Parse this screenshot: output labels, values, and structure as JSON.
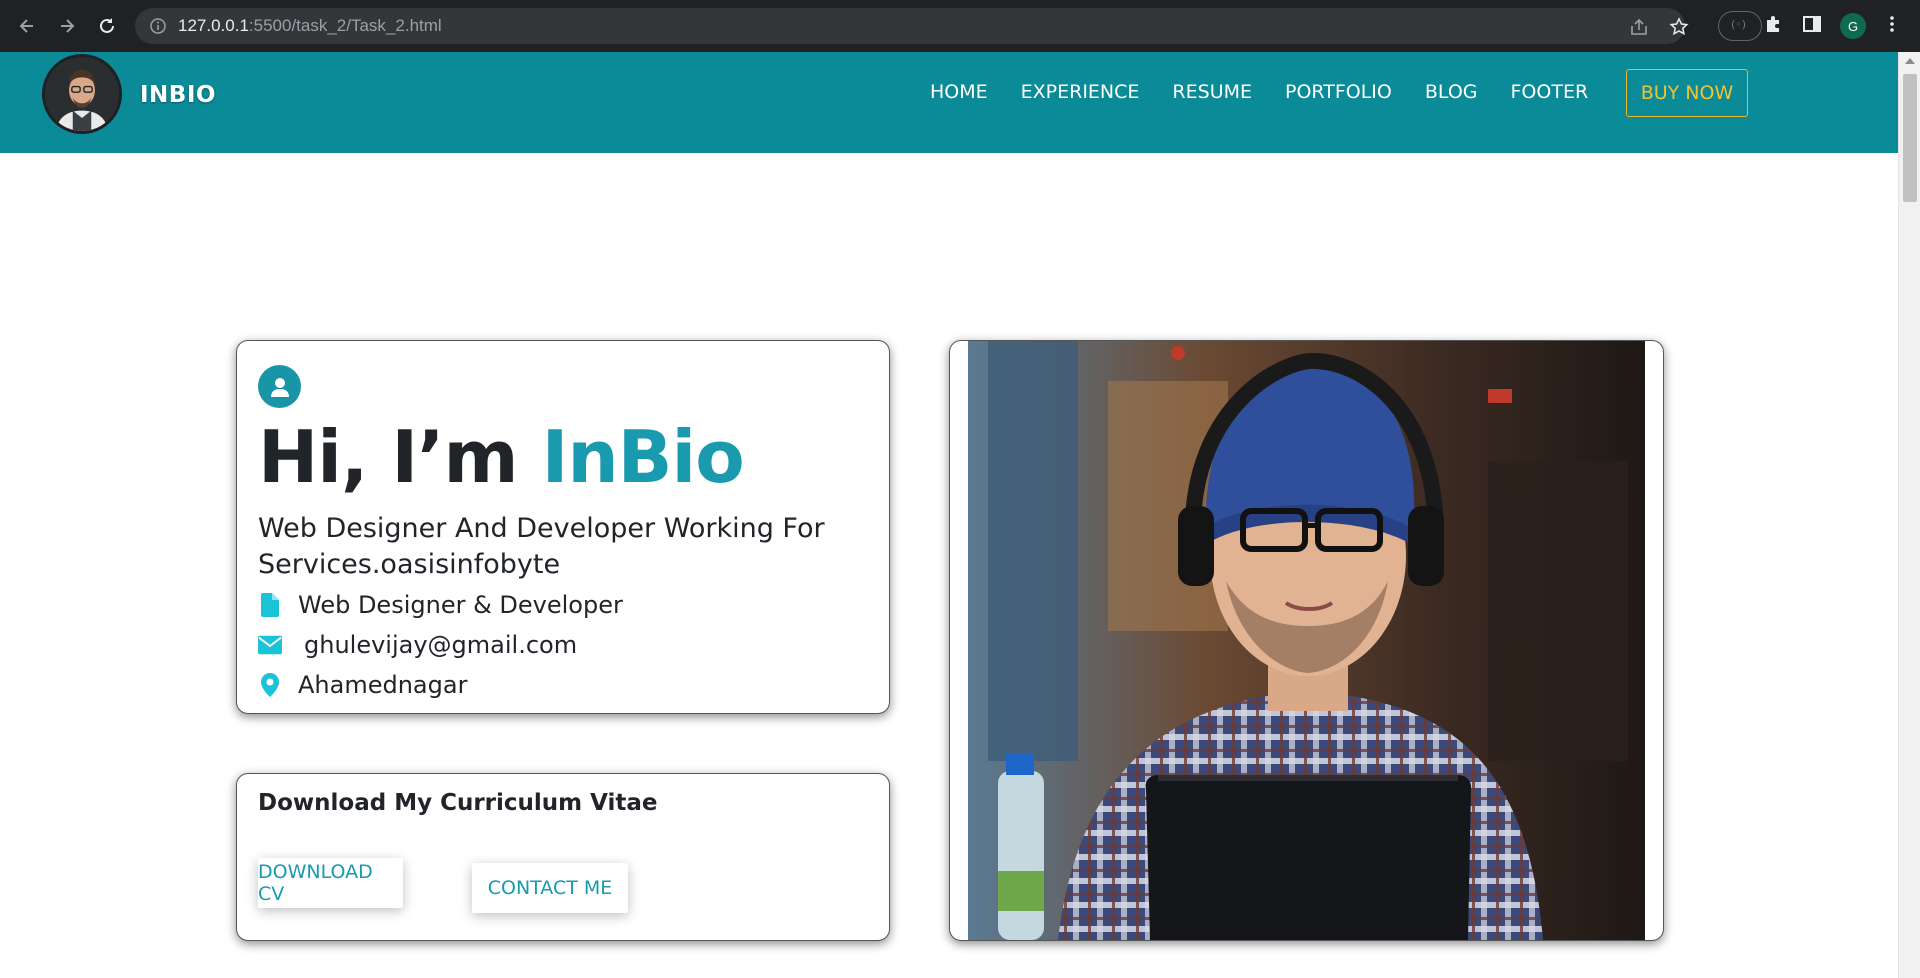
{
  "browser": {
    "url_host": "127.0.0.1",
    "url_path": ":5500/task_2/Task_2.html",
    "profile_initial": "G"
  },
  "header": {
    "logo_text": "INBIO",
    "nav": [
      {
        "label": "HOME"
      },
      {
        "label": "EXPERIENCE"
      },
      {
        "label": "RESUME"
      },
      {
        "label": "PORTFOLIO"
      },
      {
        "label": "BLOG"
      },
      {
        "label": "FOOTER"
      }
    ],
    "buy_label": "BUY NOW"
  },
  "hero": {
    "greeting": "Hi, I’m ",
    "name": "InBio",
    "subtitle": "Web Designer And Developer Working For Services.oasisinfobyte",
    "details": [
      {
        "icon": "file-icon",
        "text": "Web Designer & Developer"
      },
      {
        "icon": "envelope-icon",
        "text": "ghulevijay@gmail.com"
      },
      {
        "icon": "location-pin-icon",
        "text": "Ahamednagar"
      }
    ]
  },
  "cv": {
    "title": "Download My Curriculum Vitae",
    "download_label": "DOWNLOAD CV",
    "contact_label": "CONTACT ME"
  },
  "colors": {
    "header_bg": "#0b8a97",
    "accent": "#1a9aaf",
    "buy_border": "#e7b82c",
    "icon_cyan": "#1bc3d9"
  }
}
